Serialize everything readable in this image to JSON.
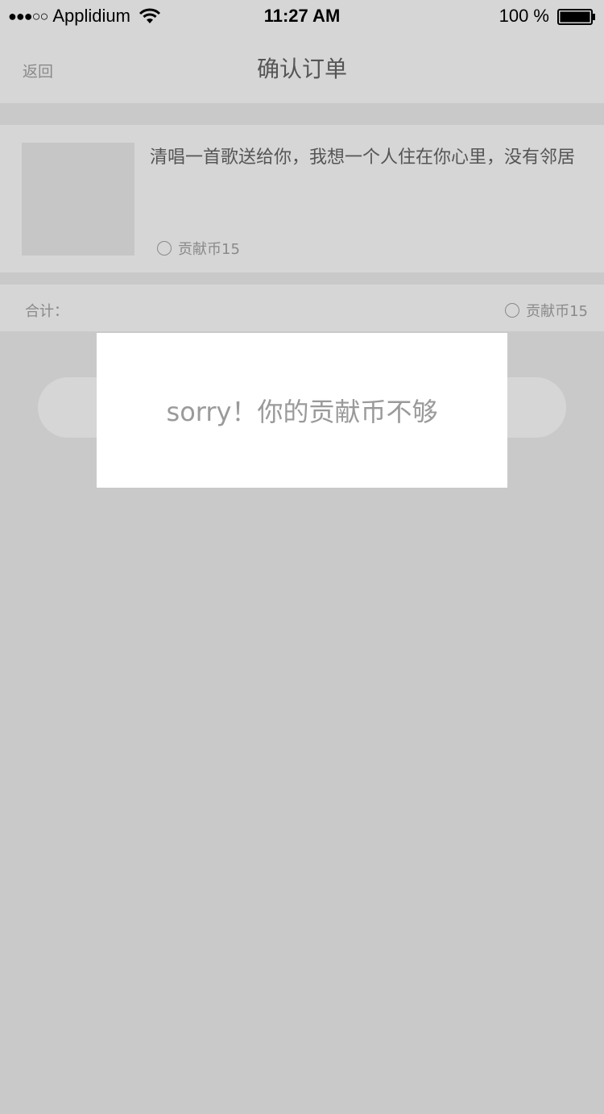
{
  "status_bar": {
    "signal": "●●●○○",
    "carrier": "Applidium",
    "time": "11:27 AM",
    "battery_percent": "100 %",
    "wifi_icon": "wifi-icon",
    "battery_icon": "battery-icon"
  },
  "nav": {
    "back_label": "返回",
    "title": "确认订单"
  },
  "order_item": {
    "title": "清唱一首歌送给你，我想一个人住在你心里，没有邻居",
    "price": "贡献币15",
    "price_icon": "radio-circle-icon"
  },
  "total": {
    "label": "合计：",
    "value": "贡献币15"
  },
  "modal": {
    "message": "sorry！你的贡献币不够"
  }
}
